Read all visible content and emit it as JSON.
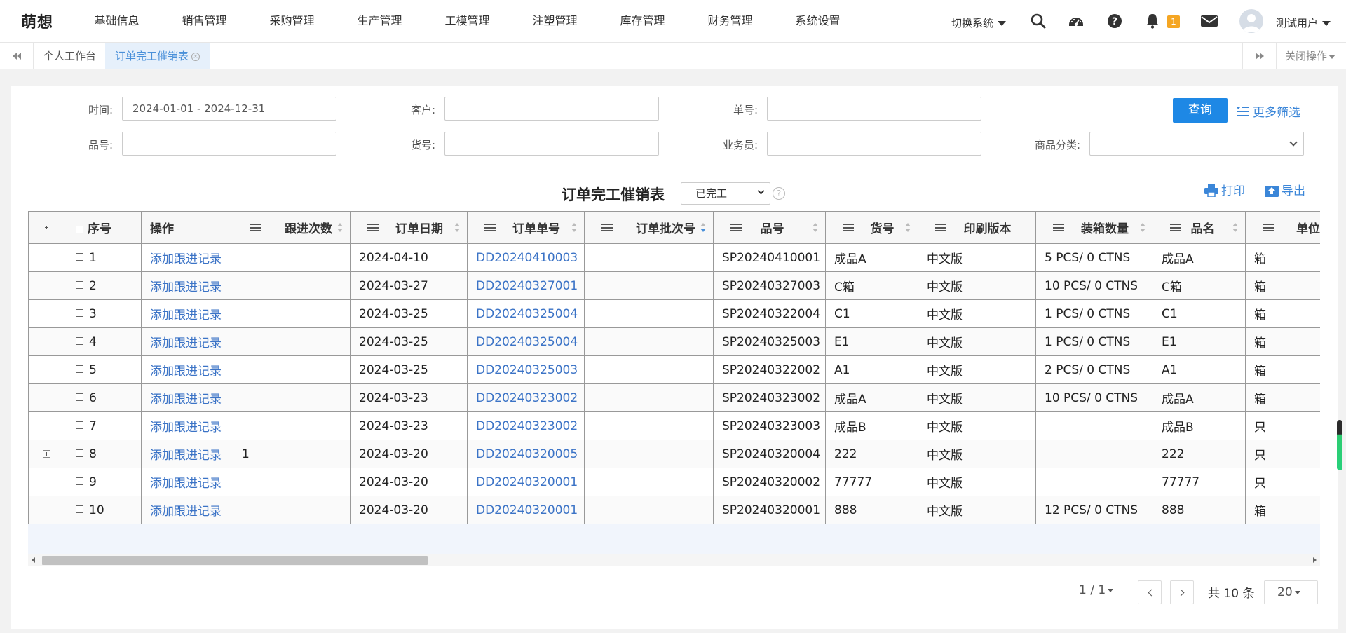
{
  "nav": {
    "logo": "萌想",
    "menu": [
      "基础信息",
      "销售管理",
      "采购管理",
      "生产管理",
      "工模管理",
      "注塑管理",
      "库存管理",
      "财务管理",
      "系统设置"
    ],
    "switch_system": "切换系统",
    "notification_count": "1",
    "username": "测试用户"
  },
  "tabs": {
    "items": [
      "个人工作台",
      "订单完工催销表"
    ],
    "active": "订单完工催销表",
    "close_ops": "关闭操作"
  },
  "filters": {
    "time_label": "时间:",
    "time_value": "2024-01-01 - 2024-12-31",
    "customer_label": "客户:",
    "customer_value": "",
    "order_no_label": "单号:",
    "order_no_value": "",
    "product_no_label": "品号:",
    "product_no_value": "",
    "goods_no_label": "货号:",
    "goods_no_value": "",
    "salesman_label": "业务员:",
    "salesman_value": "",
    "category_label": "商品分类:",
    "category_value": "",
    "query_button": "查询",
    "more_filter": "更多筛选"
  },
  "report": {
    "title": "订单完工催销表",
    "status_selected": "已完工",
    "help": "?",
    "print": "打印",
    "export": "导出"
  },
  "table": {
    "columns": [
      "序号",
      "操作",
      "跟进次数",
      "订单日期",
      "订单单号",
      "订单批次号",
      "品号",
      "货号",
      "印刷版本",
      "装箱数量",
      "品名",
      "单位"
    ],
    "sorted_column": "订单批次号",
    "sort_direction": "descending",
    "rows": [
      {
        "seq": "1",
        "op": "添加跟进记录",
        "follow": "",
        "date": "2024-04-10",
        "order": "DD20240410003",
        "batch": "",
        "pno": "SP20240410001",
        "gno": "成品A",
        "print": "中文版",
        "pack": "5 PCS/ 0 CTNS",
        "name": "成品A",
        "unit": "箱",
        "expandable": false
      },
      {
        "seq": "2",
        "op": "添加跟进记录",
        "follow": "",
        "date": "2024-03-27",
        "order": "DD20240327001",
        "batch": "",
        "pno": "SP20240327003",
        "gno": "C箱",
        "print": "中文版",
        "pack": "10 PCS/ 0 CTNS",
        "name": "C箱",
        "unit": "箱",
        "expandable": false
      },
      {
        "seq": "3",
        "op": "添加跟进记录",
        "follow": "",
        "date": "2024-03-25",
        "order": "DD20240325004",
        "batch": "",
        "pno": "SP20240322004",
        "gno": "C1",
        "print": "中文版",
        "pack": "1 PCS/ 0 CTNS",
        "name": "C1",
        "unit": "箱",
        "expandable": false
      },
      {
        "seq": "4",
        "op": "添加跟进记录",
        "follow": "",
        "date": "2024-03-25",
        "order": "DD20240325004",
        "batch": "",
        "pno": "SP20240325003",
        "gno": "E1",
        "print": "中文版",
        "pack": "1 PCS/ 0 CTNS",
        "name": "E1",
        "unit": "箱",
        "expandable": false
      },
      {
        "seq": "5",
        "op": "添加跟进记录",
        "follow": "",
        "date": "2024-03-25",
        "order": "DD20240325003",
        "batch": "",
        "pno": "SP20240322002",
        "gno": "A1",
        "print": "中文版",
        "pack": "2 PCS/ 0 CTNS",
        "name": "A1",
        "unit": "箱",
        "expandable": false
      },
      {
        "seq": "6",
        "op": "添加跟进记录",
        "follow": "",
        "date": "2024-03-23",
        "order": "DD20240323002",
        "batch": "",
        "pno": "SP20240323002",
        "gno": "成品A",
        "print": "中文版",
        "pack": "10 PCS/ 0 CTNS",
        "name": "成品A",
        "unit": "箱",
        "expandable": false
      },
      {
        "seq": "7",
        "op": "添加跟进记录",
        "follow": "",
        "date": "2024-03-23",
        "order": "DD20240323002",
        "batch": "",
        "pno": "SP20240323003",
        "gno": "成品B",
        "print": "中文版",
        "pack": "",
        "name": "成品B",
        "unit": "只",
        "expandable": false
      },
      {
        "seq": "8",
        "op": "添加跟进记录",
        "follow": "1",
        "date": "2024-03-20",
        "order": "DD20240320005",
        "batch": "",
        "pno": "SP20240320004",
        "gno": "222",
        "print": "中文版",
        "pack": "",
        "name": "222",
        "unit": "只",
        "expandable": true
      },
      {
        "seq": "9",
        "op": "添加跟进记录",
        "follow": "",
        "date": "2024-03-20",
        "order": "DD20240320001",
        "batch": "",
        "pno": "SP20240320002",
        "gno": "77777",
        "print": "中文版",
        "pack": "",
        "name": "77777",
        "unit": "只",
        "expandable": false
      },
      {
        "seq": "10",
        "op": "添加跟进记录",
        "follow": "",
        "date": "2024-03-20",
        "order": "DD20240320001",
        "batch": "",
        "pno": "SP20240320001",
        "gno": "888",
        "print": "中文版",
        "pack": "12 PCS/ 0 CTNS",
        "name": "888",
        "unit": "箱",
        "expandable": false
      }
    ]
  },
  "pagination": {
    "page_info": "1 / 1",
    "total": "共 10 条",
    "page_size": "20"
  },
  "colors": {
    "primary": "#1e88e5",
    "link": "#3b73c6",
    "badge": "#f5a623",
    "active_tab_bg": "#e6f0fb"
  }
}
